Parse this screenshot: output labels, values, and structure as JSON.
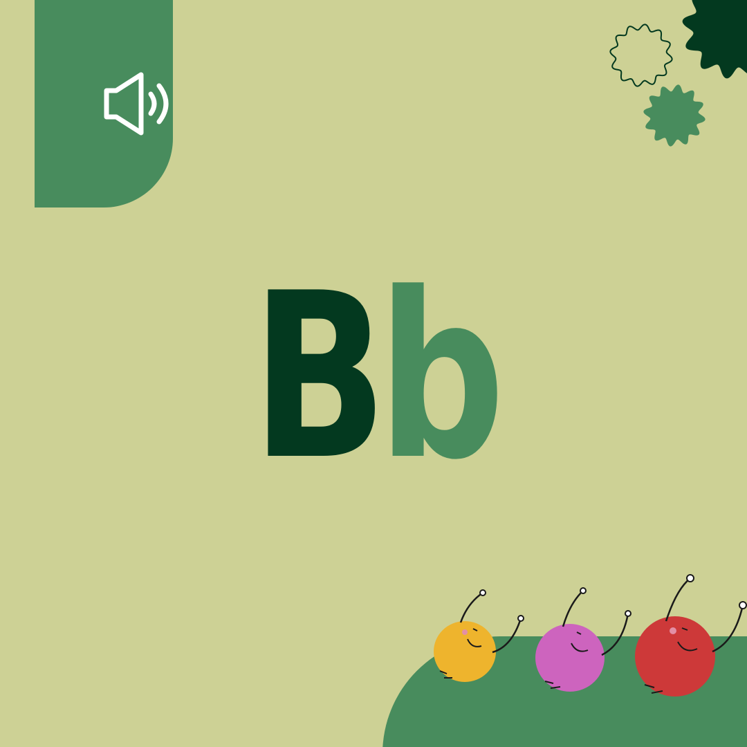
{
  "letters": {
    "upper": "B",
    "lower": "b"
  },
  "colors": {
    "background": "#cdd195",
    "accent_green": "#488c5d",
    "dark_green": "#03391f",
    "creature_yellow": "#eeb42d",
    "creature_purple": "#cd64be",
    "creature_red": "#cd3939"
  },
  "icons": {
    "sound": "speaker-volume-icon"
  }
}
